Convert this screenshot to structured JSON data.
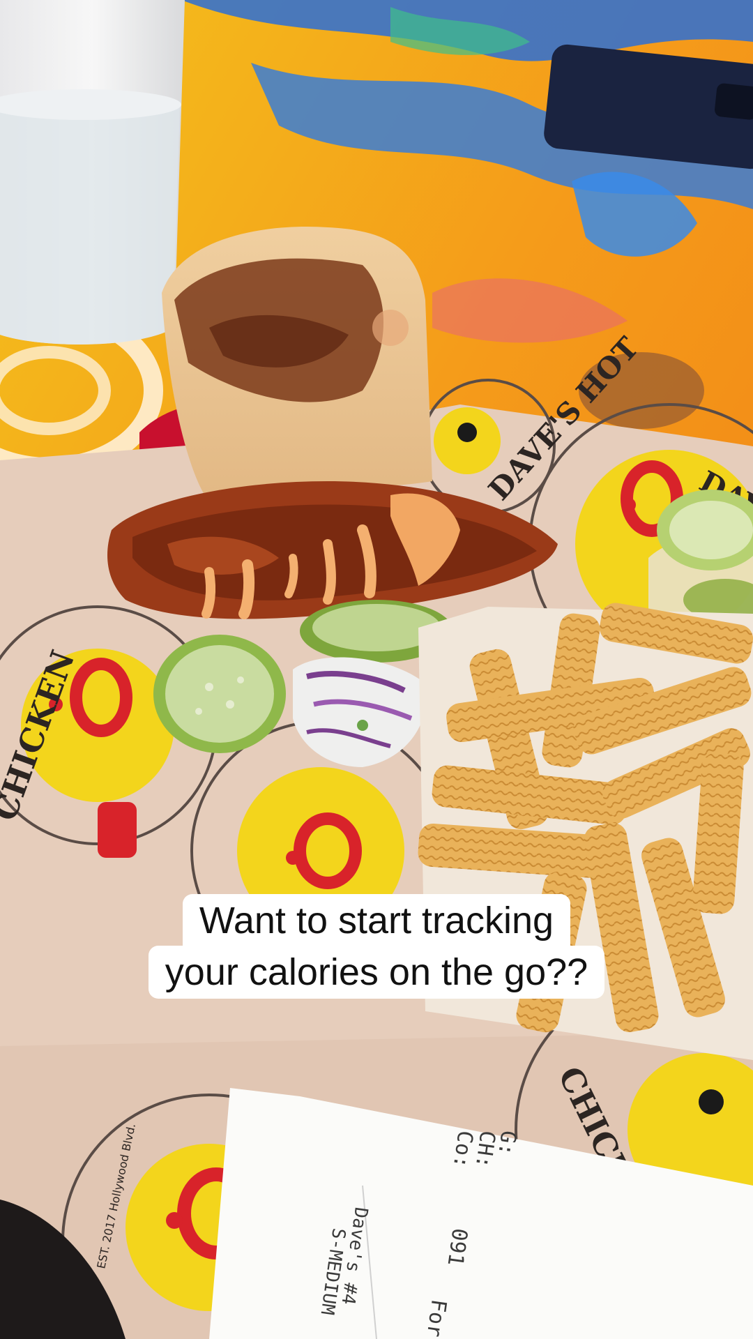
{
  "caption": {
    "line1": "Want to start tracking",
    "line2": "your calories on the go??"
  },
  "wrapper_print": {
    "brand_top_left": "DAVE'S HOT",
    "brand_top_right": "DAVE'S HOT",
    "brand_bottom_left": "CHICKEN",
    "brand_bottom_right": "CHICKEN",
    "est": "EST. 2017 Hollywood Blvd."
  },
  "receipt": {
    "line_g": "G:",
    "line_ch": "CH:",
    "line_co": "Co:",
    "order_number": "091",
    "item_1": "Dave's #4",
    "item_2": "S-MEDIUM",
    "footer": "For"
  },
  "colors": {
    "table_orange": "#f6a21a",
    "table_blue": "#2b6fd6",
    "paper": "#e9d2c2",
    "logo_red": "#d8232a",
    "logo_yellow": "#f3d51c"
  }
}
